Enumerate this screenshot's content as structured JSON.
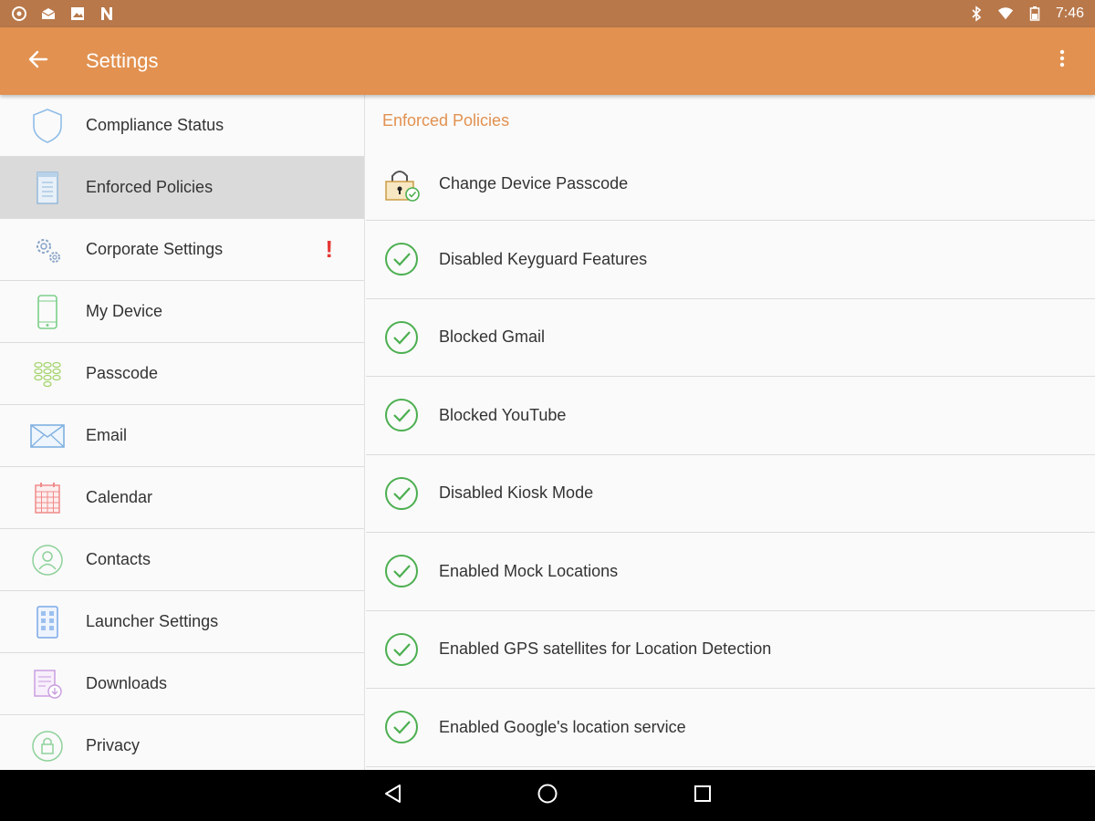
{
  "status_bar": {
    "left_icons": [
      "settings-circle-icon",
      "mail-icon",
      "image-icon",
      "n-logo-icon"
    ],
    "right_icons": [
      "bluetooth-icon",
      "wifi-icon",
      "battery-icon"
    ],
    "time": "7:46"
  },
  "app_bar": {
    "title": "Settings",
    "back_icon": "back-arrow-icon",
    "menu_icon": "more-vert-icon",
    "color": "#e29150"
  },
  "sidebar": {
    "selected_index": 1,
    "items": [
      {
        "label": "Compliance Status",
        "icon": "shield-icon"
      },
      {
        "label": "Enforced Policies",
        "icon": "document-icon"
      },
      {
        "label": "Corporate Settings",
        "icon": "gears-icon",
        "alert": "!"
      },
      {
        "label": "My Device",
        "icon": "phone-icon"
      },
      {
        "label": "Passcode",
        "icon": "keypad-icon"
      },
      {
        "label": "Email",
        "icon": "envelope-icon"
      },
      {
        "label": "Calendar",
        "icon": "calendar-icon"
      },
      {
        "label": "Contacts",
        "icon": "contact-icon"
      },
      {
        "label": "Launcher Settings",
        "icon": "launcher-icon"
      },
      {
        "label": "Downloads",
        "icon": "downloads-icon"
      },
      {
        "label": "Privacy",
        "icon": "privacy-lock-icon"
      }
    ]
  },
  "main": {
    "section_title": "Enforced Policies",
    "policies": [
      {
        "label": "Change Device Passcode",
        "icon": "lock-check-icon"
      },
      {
        "label": "Disabled Keyguard Features",
        "icon": "check-circle-icon"
      },
      {
        "label": "Blocked Gmail",
        "icon": "check-circle-icon"
      },
      {
        "label": "Blocked YouTube",
        "icon": "check-circle-icon"
      },
      {
        "label": "Disabled Kiosk Mode",
        "icon": "check-circle-icon"
      },
      {
        "label": "Enabled Mock Locations",
        "icon": "check-circle-icon"
      },
      {
        "label": "Enabled GPS satellites for Location Detection",
        "icon": "check-circle-icon"
      },
      {
        "label": "Enabled Google's location service",
        "icon": "check-circle-icon"
      }
    ]
  },
  "nav_bar": {
    "buttons": [
      "back-triangle-icon",
      "home-circle-icon",
      "recents-square-icon"
    ]
  },
  "colors": {
    "status_bar": "#b8784a",
    "accent": "#e29150",
    "check_green": "#4caf50",
    "alert_red": "#e53935",
    "selected_row": "#dadada"
  }
}
